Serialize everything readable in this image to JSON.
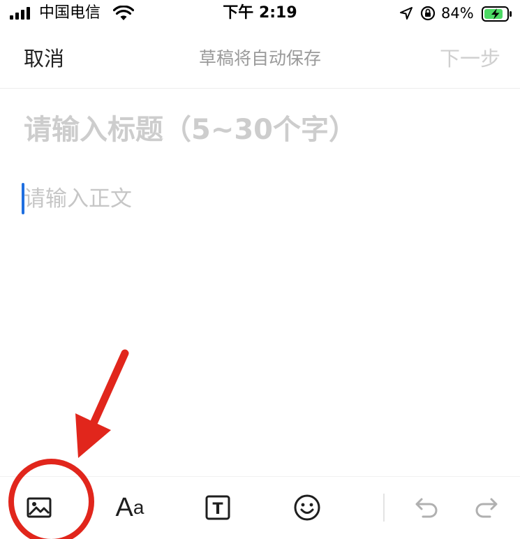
{
  "status_bar": {
    "carrier": "中国电信",
    "time": "下午 2:19",
    "battery_percent": "84%",
    "signal_icon": "signal-bars-icon",
    "wifi_icon": "wifi-icon",
    "location_icon": "location-arrow-icon",
    "orientation_lock_icon": "orientation-lock-icon",
    "battery_icon": "battery-charging-icon",
    "battery_level": 0.84,
    "battery_color": "#4cd964"
  },
  "nav": {
    "cancel_label": "取消",
    "draft_status": "草稿将自动保存",
    "next_label": "下一步"
  },
  "editor": {
    "title_placeholder": "请输入标题（5~30个字）",
    "body_placeholder": "请输入正文",
    "caret_color": "#1f6fe0"
  },
  "annotation": {
    "color": "#e1261c",
    "shapes": [
      "arrow",
      "circle"
    ]
  },
  "toolbar": {
    "image_icon": "image-icon",
    "font_label_big": "A",
    "font_label_small": "a",
    "text_box_icon": "text-box-icon",
    "text_box_letter": "T",
    "emoji_icon": "emoji-icon",
    "undo_icon": "undo-icon",
    "redo_icon": "redo-icon"
  }
}
